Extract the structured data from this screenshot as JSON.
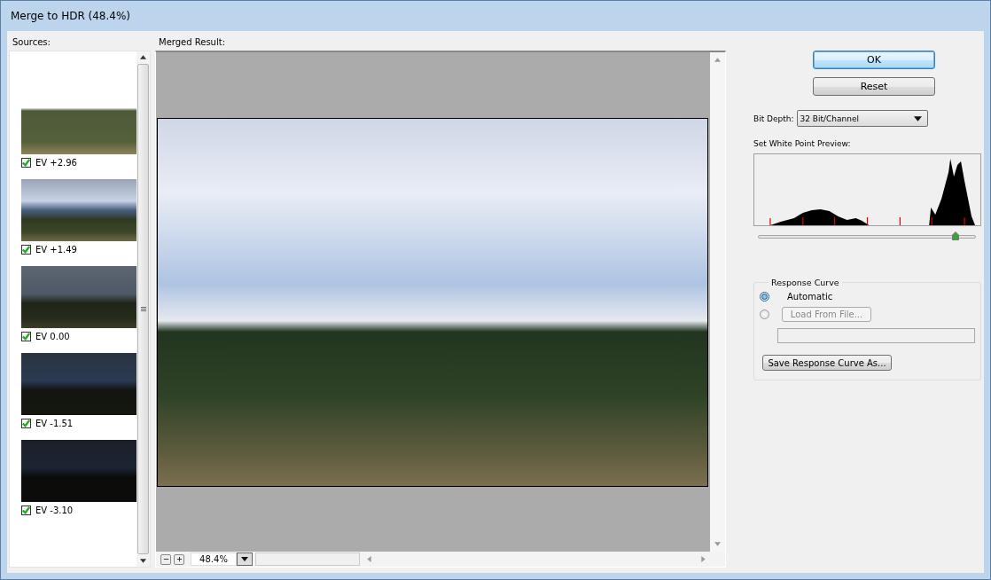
{
  "window": {
    "title": "Merge to HDR (48.4%)"
  },
  "sources": {
    "label": "Sources:",
    "items": [
      {
        "label": "EV +2.96",
        "checked": true
      },
      {
        "label": "EV +1.49",
        "checked": true
      },
      {
        "label": "EV 0.00",
        "checked": true
      },
      {
        "label": "EV -1.51",
        "checked": true
      },
      {
        "label": "EV -3.10",
        "checked": true
      }
    ]
  },
  "merged_result": {
    "label": "Merged Result:",
    "zoom": "48.4%"
  },
  "buttons": [
    {
      "label": "OK",
      "selected": true
    },
    {
      "label": "Reset",
      "selected": false
    }
  ],
  "bit_depth": {
    "label": "Bit Depth:",
    "value": "32 Bit/Channel"
  },
  "white_point": {
    "label": "Set White Point Preview:",
    "level": 0.91
  },
  "response_curve": {
    "title": "Response Curve",
    "options": [
      {
        "kind": "label",
        "label": "Automatic",
        "selected": true,
        "disabled": false
      },
      {
        "kind": "button",
        "label": "Load From File...",
        "selected": false,
        "disabled": true
      }
    ],
    "save_button": "Save Response Curve As..."
  }
}
